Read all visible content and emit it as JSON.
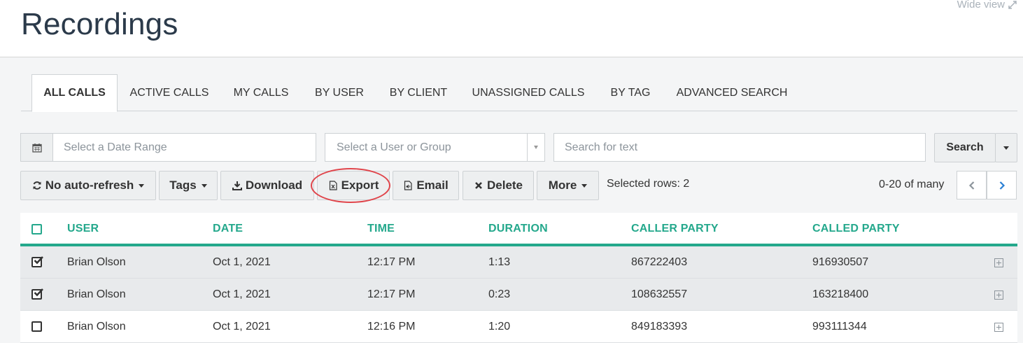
{
  "header": {
    "title": "Recordings",
    "wide_view_label": "Wide view"
  },
  "tabs": [
    {
      "label": "ALL CALLS",
      "active": true
    },
    {
      "label": "ACTIVE CALLS",
      "active": false
    },
    {
      "label": "MY CALLS",
      "active": false
    },
    {
      "label": "BY USER",
      "active": false
    },
    {
      "label": "BY CLIENT",
      "active": false
    },
    {
      "label": "UNASSIGNED CALLS",
      "active": false
    },
    {
      "label": "BY TAG",
      "active": false
    },
    {
      "label": "ADVANCED SEARCH",
      "active": false
    }
  ],
  "filters": {
    "date_range_placeholder": "Select a Date Range",
    "user_group_placeholder": "Select a User or Group",
    "text_search_placeholder": "Search for text",
    "search_button": "Search"
  },
  "toolbar": {
    "refresh_label": "No auto-refresh",
    "tags_label": "Tags",
    "download_label": "Download",
    "export_label": "Export",
    "email_label": "Email",
    "delete_label": "Delete",
    "more_label": "More",
    "selected_rows": "Selected rows: 2",
    "pager_text": "0-20 of many"
  },
  "table": {
    "columns": [
      "USER",
      "DATE",
      "TIME",
      "DURATION",
      "CALLER PARTY",
      "CALLED PARTY"
    ],
    "rows": [
      {
        "checked": true,
        "user": "Brian Olson",
        "date": "Oct 1, 2021",
        "time": "12:17 PM",
        "duration": "1:13",
        "caller": "867222403",
        "called": "916930507"
      },
      {
        "checked": true,
        "user": "Brian Olson",
        "date": "Oct 1, 2021",
        "time": "12:17 PM",
        "duration": "0:23",
        "caller": "108632557",
        "called": "163218400"
      },
      {
        "checked": false,
        "user": "Brian Olson",
        "date": "Oct 1, 2021",
        "time": "12:16 PM",
        "duration": "1:20",
        "caller": "849183393",
        "called": "993111344"
      }
    ]
  },
  "colors": {
    "accent": "#24a88c",
    "title": "#2b3a4a",
    "highlight_circle": "#e0444a"
  }
}
